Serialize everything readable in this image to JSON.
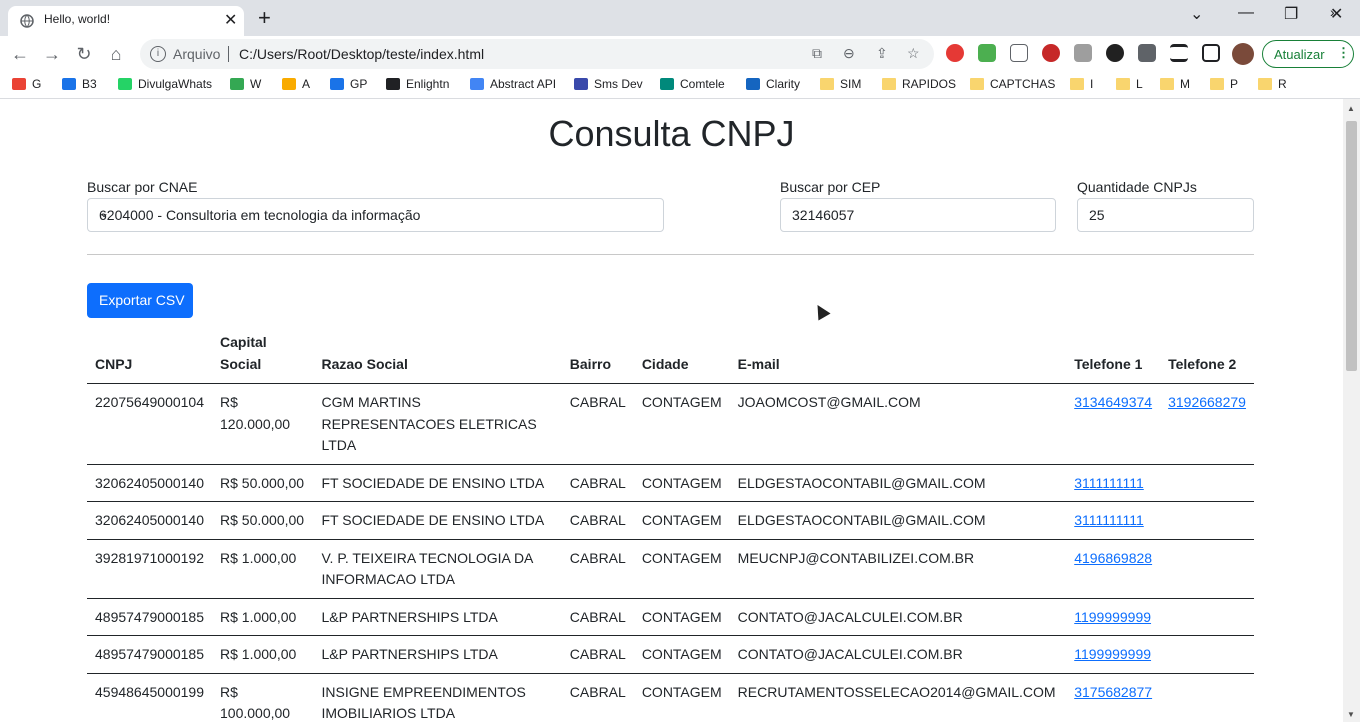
{
  "browser": {
    "tab_title": "Hello, world!",
    "address_prefix": "Arquivo",
    "url": "C:/Users/Root/Desktop/teste/index.html",
    "update_label": "Atualizar",
    "bookmarks": [
      "G",
      "B3",
      "DivulgaWhats",
      "W",
      "A",
      "GP",
      "Enlightn",
      "Abstract API",
      "Sms Dev",
      "Comtele",
      "Clarity",
      "SIM",
      "RAPIDOS",
      "CAPTCHAS",
      "I",
      "L",
      "M",
      "P",
      "R"
    ]
  },
  "page": {
    "title": "Consulta CNPJ",
    "cnae": {
      "label": "Buscar por CNAE",
      "value": "6204000 - Consultoria em tecnologia da informação"
    },
    "cep": {
      "label": "Buscar por CEP",
      "value": "32146057"
    },
    "quantidade": {
      "label": "Quantidade CNPJs",
      "value": "25"
    },
    "export_label": "Exportar CSV",
    "table": {
      "headers": [
        "CNPJ",
        "Capital Social",
        "Razao Social",
        "Bairro",
        "Cidade",
        "E-mail",
        "Telefone 1",
        "Telefone 2"
      ],
      "rows": [
        {
          "cnpj": "22075649000104",
          "capital": "R$ 120.000,00",
          "razao": "CGM MARTINS REPRESENTACOES ELETRICAS LTDA",
          "bairro": "CABRAL",
          "cidade": "CONTAGEM",
          "email": "JOAOMCOST@GMAIL.COM",
          "tel1": "3134649374",
          "tel2": "3192668279"
        },
        {
          "cnpj": "32062405000140",
          "capital": "R$ 50.000,00",
          "razao": "FT SOCIEDADE DE ENSINO LTDA",
          "bairro": "CABRAL",
          "cidade": "CONTAGEM",
          "email": "ELDGESTAOCONTABIL@GMAIL.COM",
          "tel1": "3111111111",
          "tel2": ""
        },
        {
          "cnpj": "32062405000140",
          "capital": "R$ 50.000,00",
          "razao": "FT SOCIEDADE DE ENSINO LTDA",
          "bairro": "CABRAL",
          "cidade": "CONTAGEM",
          "email": "ELDGESTAOCONTABIL@GMAIL.COM",
          "tel1": "3111111111",
          "tel2": ""
        },
        {
          "cnpj": "39281971000192",
          "capital": "R$ 1.000,00",
          "razao": "V. P. TEIXEIRA TECNOLOGIA DA INFORMACAO LTDA",
          "bairro": "CABRAL",
          "cidade": "CONTAGEM",
          "email": "MEUCNPJ@CONTABILIZEI.COM.BR",
          "tel1": "4196869828",
          "tel2": ""
        },
        {
          "cnpj": "48957479000185",
          "capital": "R$ 1.000,00",
          "razao": "L&P PARTNERSHIPS LTDA",
          "bairro": "CABRAL",
          "cidade": "CONTAGEM",
          "email": "CONTATO@JACALCULEI.COM.BR",
          "tel1": "1199999999",
          "tel2": ""
        },
        {
          "cnpj": "48957479000185",
          "capital": "R$ 1.000,00",
          "razao": "L&P PARTNERSHIPS LTDA",
          "bairro": "CABRAL",
          "cidade": "CONTAGEM",
          "email": "CONTATO@JACALCULEI.COM.BR",
          "tel1": "1199999999",
          "tel2": ""
        },
        {
          "cnpj": "45948645000199",
          "capital": "R$ 100.000,00",
          "razao": "INSIGNE EMPREENDIMENTOS IMOBILIARIOS LTDA",
          "bairro": "CABRAL",
          "cidade": "CONTAGEM",
          "email": "RECRUTAMENTOSSELECAO2014@GMAIL.COM",
          "tel1": "3175682877",
          "tel2": ""
        }
      ]
    }
  }
}
